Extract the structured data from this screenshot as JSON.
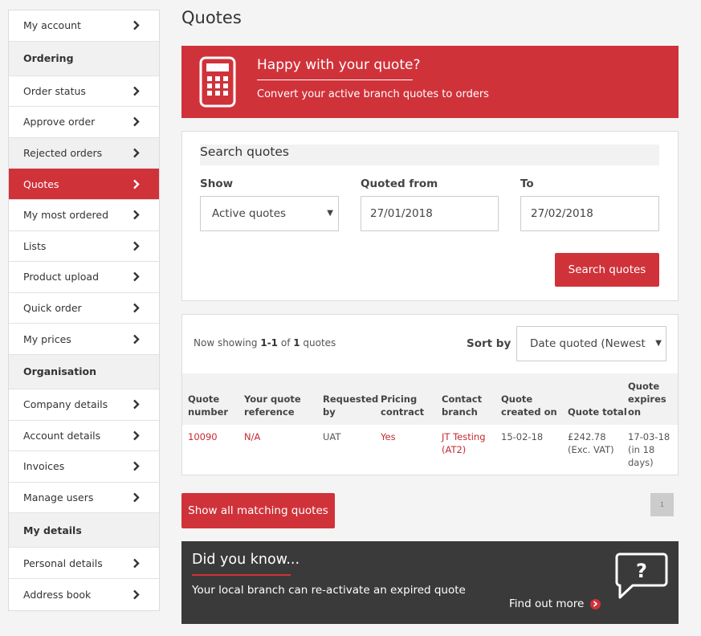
{
  "sidebar": {
    "items": [
      {
        "label": "My account",
        "type": "link"
      },
      {
        "label": "Ordering",
        "type": "header"
      },
      {
        "label": "Order status",
        "type": "link"
      },
      {
        "label": "Approve order",
        "type": "link"
      },
      {
        "label": "Rejected orders",
        "type": "link"
      },
      {
        "label": "Quotes",
        "type": "active"
      },
      {
        "label": "My most ordered",
        "type": "link"
      },
      {
        "label": "Lists",
        "type": "link"
      },
      {
        "label": "Product upload",
        "type": "link"
      },
      {
        "label": "Quick order",
        "type": "link"
      },
      {
        "label": "My prices",
        "type": "link"
      },
      {
        "label": "Organisation",
        "type": "header"
      },
      {
        "label": "Company details",
        "type": "link"
      },
      {
        "label": "Account details",
        "type": "link"
      },
      {
        "label": "Invoices",
        "type": "link"
      },
      {
        "label": "Manage users",
        "type": "link"
      },
      {
        "label": "My details",
        "type": "header"
      },
      {
        "label": "Personal details",
        "type": "link"
      },
      {
        "label": "Address book",
        "type": "link"
      }
    ]
  },
  "page": {
    "title": "Quotes"
  },
  "promo": {
    "heading": "Happy with your quote?",
    "subtext": "Convert your active branch quotes to orders",
    "icon": "calculator-icon"
  },
  "search": {
    "title": "Search quotes",
    "show_label": "Show",
    "show_value": "Active quotes",
    "from_label": "Quoted from",
    "from_value": "27/01/2018",
    "to_label": "To",
    "to_value": "27/02/2018",
    "button": "Search quotes"
  },
  "results": {
    "showing_prefix": "Now showing ",
    "showing_range": "1-1",
    "showing_of": " of ",
    "showing_total": "1",
    "showing_suffix": " quotes",
    "sort_label": "Sort by",
    "sort_value": "Date quoted (Newest",
    "columns": {
      "quote_number": [
        "Quote",
        "number"
      ],
      "reference": [
        "Your quote",
        "reference"
      ],
      "requested_by": [
        "Requested",
        "by"
      ],
      "pricing": [
        "Pricing",
        "contract"
      ],
      "branch": [
        "Contact",
        "branch"
      ],
      "created": [
        "Quote",
        "created on"
      ],
      "total": [
        "Quote total"
      ],
      "expires": [
        "Quote",
        "expires",
        "on"
      ]
    },
    "row": {
      "quote_number": "10090",
      "reference": "N/A",
      "requested_by": "UAT",
      "pricing": "Yes",
      "branch": [
        "JT Testing",
        "(AT2)"
      ],
      "created": "15-02-18",
      "total": [
        "£242.78",
        "(Exc. VAT)"
      ],
      "expires": [
        "17-03-18",
        "(in 18",
        "days)"
      ]
    }
  },
  "show_all_button": "Show all matching quotes",
  "pagination": {
    "current": "1"
  },
  "did_you_know": {
    "heading": "Did you know...",
    "body": "Your local branch can re-activate an expired quote",
    "link": "Find out more",
    "icon": "question-bubble-icon"
  },
  "colors": {
    "accent": "#d0323a",
    "dark_panel": "#3a3a3a"
  }
}
